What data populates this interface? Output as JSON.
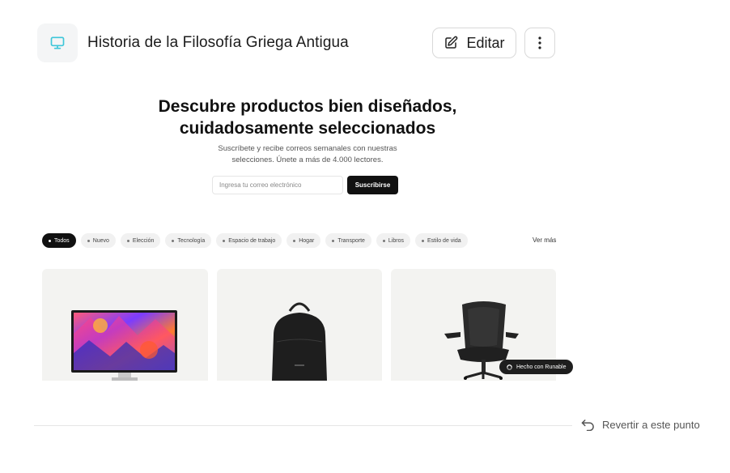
{
  "header": {
    "title": "Historia de la Filosofía Griega Antigua",
    "app_icon": "monitor-icon",
    "edit_label": "Editar",
    "edit_icon": "pencil-square-icon",
    "more_icon": "more-vertical-icon",
    "accent_color": "#3ec6d9"
  },
  "hero": {
    "title_line1": "Descubre productos bien diseñados,",
    "title_line2": "cuidadosamente seleccionados",
    "subtitle_line1": "Suscríbete y recibe correos semanales con nuestras",
    "subtitle_line2": "selecciones. Únete a más de 4.000 lectores.",
    "email_placeholder": "Ingresa tu correo electrónico",
    "subscribe_label": "Suscribirse"
  },
  "filters": {
    "items": [
      {
        "label": "Todos",
        "active": true
      },
      {
        "label": "Nuevo",
        "active": false
      },
      {
        "label": "Elección",
        "active": false
      },
      {
        "label": "Tecnología",
        "active": false
      },
      {
        "label": "Espacio de trabajo",
        "active": false
      },
      {
        "label": "Hogar",
        "active": false
      },
      {
        "label": "Transporte",
        "active": false
      },
      {
        "label": "Libros",
        "active": false
      },
      {
        "label": "Estilo de vida",
        "active": false
      }
    ],
    "see_more": "Ver más"
  },
  "products": [
    {
      "image": "display-monitor-image"
    },
    {
      "image": "black-backpack-image"
    },
    {
      "image": "office-chair-image"
    }
  ],
  "badge": {
    "label": "Hecho con Runable",
    "icon": "runable-logo-icon"
  },
  "footer": {
    "revert_label": "Revertir a este punto",
    "revert_icon": "undo-arrow-icon"
  }
}
